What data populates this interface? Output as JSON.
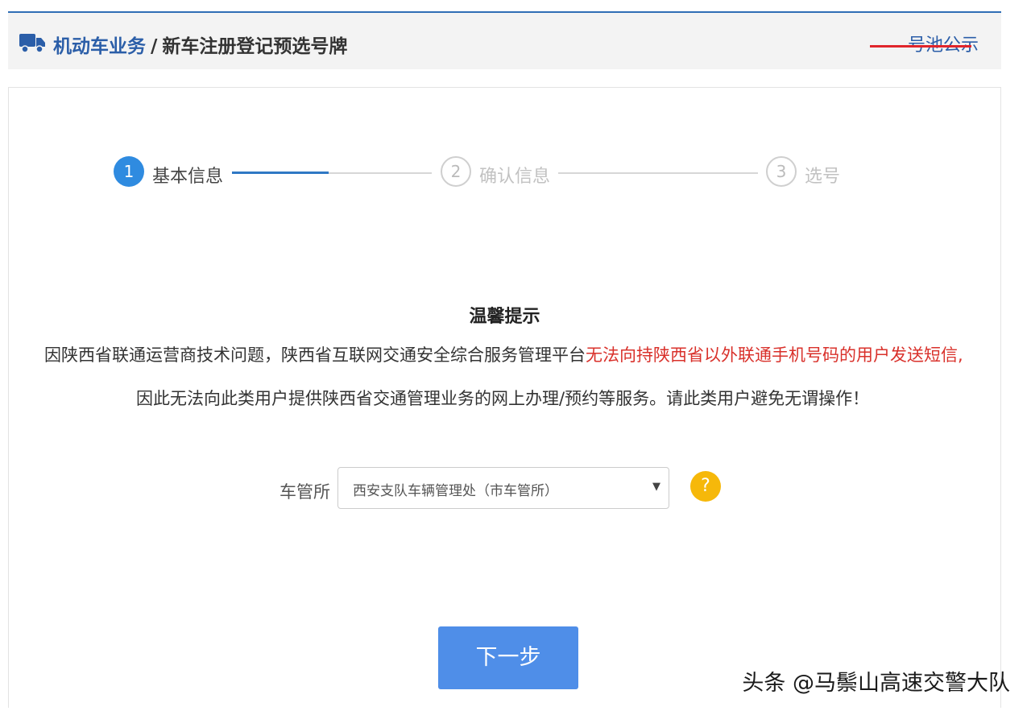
{
  "header": {
    "category": "机动车业务",
    "separator": "/",
    "page_title": "新车注册登记预选号牌",
    "pool_link": "号池公示"
  },
  "steps": [
    {
      "number": "1",
      "label": "基本信息",
      "state": "active"
    },
    {
      "number": "2",
      "label": "确认信息",
      "state": "inactive"
    },
    {
      "number": "3",
      "label": "选号",
      "state": "inactive"
    }
  ],
  "notice": {
    "title": "温馨提示",
    "line1_normal": "因陕西省联通运营商技术问题，陕西省互联网交通安全综合服务管理平台",
    "line1_highlight": "无法向持陕西省以外联通手机号码的用户发送短信,",
    "line2": "因此无法向此类用户提供陕西省交通管理业务的网上办理/预约等服务。请此类用户避免无谓操作！"
  },
  "form": {
    "office_label": "车管所",
    "office_value": "西安支队车辆管理处（市车管所）",
    "help_icon": "?"
  },
  "actions": {
    "next_label": "下一步"
  },
  "watermark": "头条 @马鬃山高速交警大队",
  "colors": {
    "brand_blue": "#2b5ea8",
    "step_active": "#2f8be0",
    "alert_red": "#d9312b",
    "button_blue": "#4f8ee8",
    "help_yellow": "#f6b80a"
  }
}
